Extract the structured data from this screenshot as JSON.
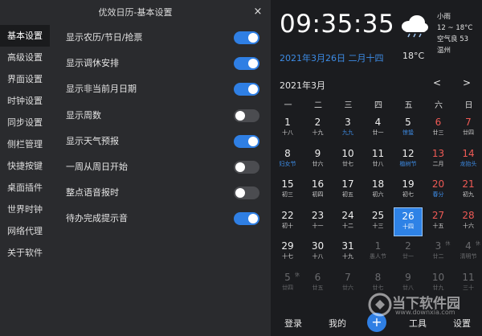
{
  "settings": {
    "title": "优效日历-基本设置",
    "close": "×",
    "nav": [
      "基本设置",
      "高级设置",
      "界面设置",
      "时钟设置",
      "同步设置",
      "侧栏管理",
      "快捷按键",
      "桌面插件",
      "世界时钟",
      "网络代理",
      "关于软件"
    ],
    "active_nav": 0,
    "options": [
      {
        "label": "显示农历/节日/抢票",
        "on": true
      },
      {
        "label": "显示调休安排",
        "on": true
      },
      {
        "label": "显示非当前月日期",
        "on": true
      },
      {
        "label": "显示周数",
        "on": false
      },
      {
        "label": "显示天气预报",
        "on": true
      },
      {
        "label": "一周从周日开始",
        "on": false
      },
      {
        "label": "整点语音报时",
        "on": false
      },
      {
        "label": "待办完成提示音",
        "on": true
      }
    ]
  },
  "calendar": {
    "clock": "09:35:35",
    "weather": {
      "condition": "小雨",
      "range": "12 ~ 18°C",
      "air": "空气良 53",
      "city": "温州"
    },
    "date_line": "2021年3月26日  二月十四",
    "temperature": "18°C",
    "month": "2021年3月",
    "prev": "<",
    "next": ">",
    "weekdays": [
      "一",
      "二",
      "三",
      "四",
      "五",
      "六",
      "日"
    ],
    "days": [
      {
        "n": "1",
        "s": "十八"
      },
      {
        "n": "2",
        "s": "十九"
      },
      {
        "n": "3",
        "s": "九九",
        "blue": true
      },
      {
        "n": "4",
        "s": "廿一"
      },
      {
        "n": "5",
        "s": "惊蛰",
        "blue": true
      },
      {
        "n": "6",
        "s": "廿三",
        "wkend": true
      },
      {
        "n": "7",
        "s": "廿四",
        "wkend": true
      },
      {
        "n": "8",
        "s": "妇女节",
        "blue": true
      },
      {
        "n": "9",
        "s": "廿六"
      },
      {
        "n": "10",
        "s": "廿七"
      },
      {
        "n": "11",
        "s": "廿八"
      },
      {
        "n": "12",
        "s": "植树节",
        "blue": true
      },
      {
        "n": "13",
        "s": "二月",
        "wkend": true
      },
      {
        "n": "14",
        "s": "龙抬头",
        "wkend": true,
        "blue": true
      },
      {
        "n": "15",
        "s": "初三"
      },
      {
        "n": "16",
        "s": "初四"
      },
      {
        "n": "17",
        "s": "初五"
      },
      {
        "n": "18",
        "s": "初六"
      },
      {
        "n": "19",
        "s": "初七"
      },
      {
        "n": "20",
        "s": "春分",
        "wkend": true,
        "blue": true
      },
      {
        "n": "21",
        "s": "初九",
        "wkend": true
      },
      {
        "n": "22",
        "s": "初十"
      },
      {
        "n": "23",
        "s": "十一"
      },
      {
        "n": "24",
        "s": "十二"
      },
      {
        "n": "25",
        "s": "十三"
      },
      {
        "n": "26",
        "s": "十四",
        "today": true
      },
      {
        "n": "27",
        "s": "十五",
        "wkend": true
      },
      {
        "n": "28",
        "s": "十六",
        "wkend": true
      },
      {
        "n": "29",
        "s": "十七"
      },
      {
        "n": "30",
        "s": "十八"
      },
      {
        "n": "31",
        "s": "十九"
      },
      {
        "n": "1",
        "s": "愚人节",
        "other": true
      },
      {
        "n": "2",
        "s": "廿一",
        "other": true
      },
      {
        "n": "3",
        "s": "廿二",
        "other": true,
        "tag": "休"
      },
      {
        "n": "4",
        "s": "清明节",
        "other": true,
        "tag": "休"
      },
      {
        "n": "5",
        "s": "廿四",
        "other": true,
        "tag": "休"
      },
      {
        "n": "6",
        "s": "廿五",
        "other": true
      },
      {
        "n": "7",
        "s": "廿六",
        "other": true
      },
      {
        "n": "8",
        "s": "廿七",
        "other": true
      },
      {
        "n": "9",
        "s": "廿八",
        "other": true
      },
      {
        "n": "10",
        "s": "廿九",
        "other": true
      },
      {
        "n": "11",
        "s": "三十",
        "other": true
      }
    ],
    "bottom": {
      "login": "登录",
      "mine": "我的",
      "add": "+",
      "tools": "工具",
      "settings": "设置"
    }
  },
  "watermark": {
    "text": "当下软件园",
    "sub": "www.downxia.com"
  },
  "colors": {
    "accent": "#2f7fe4",
    "weekend": "#ef5a55",
    "festival": "#3d8ce6",
    "panel": "#2a2b2e",
    "calendar_bg": "#1b1c1f"
  }
}
